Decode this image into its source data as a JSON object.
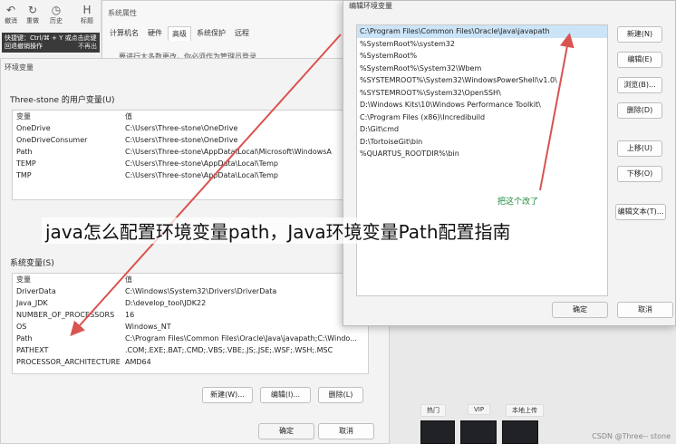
{
  "toolbar": {
    "items": [
      {
        "label": "撤消",
        "icon": "undo-icon"
      },
      {
        "label": "重做",
        "icon": "redo-icon"
      },
      {
        "label": "历史",
        "icon": "history-icon"
      },
      {
        "label": "标题",
        "icon": "heading-icon"
      }
    ],
    "tooltip": {
      "line1": "快捷键：Ctrl/⌘ + Y 或点击此键",
      "line2": "回退撤销操作",
      "right": "不再出"
    }
  },
  "system_properties": {
    "title": "系统属性",
    "tabs": [
      "计算机名",
      "硬件",
      "高级",
      "系统保护",
      "远程"
    ],
    "active_tab": "高级",
    "line": "要进行大多数更改，你必须作为管理员登录"
  },
  "env_window": {
    "title": "环境变量",
    "user_section": "Three-stone 的用户变量(U)",
    "user_headers": [
      "变量",
      "值"
    ],
    "user_vars": [
      [
        "OneDrive",
        "C:\\Users\\Three-stone\\OneDrive"
      ],
      [
        "OneDriveConsumer",
        "C:\\Users\\Three-stone\\OneDrive"
      ],
      [
        "Path",
        "C:\\Users\\Three-stone\\AppData\\Local\\Microsoft\\WindowsA"
      ],
      [
        "TEMP",
        "C:\\Users\\Three-stone\\AppData\\Local\\Temp"
      ],
      [
        "TMP",
        "C:\\Users\\Three-stone\\AppData\\Local\\Temp"
      ]
    ],
    "system_section": "系统变量(S)",
    "system_headers": [
      "变量",
      "值"
    ],
    "system_vars": [
      [
        "DriverData",
        "C:\\Windows\\System32\\Drivers\\DriverData"
      ],
      [
        "Java_JDK",
        "D:\\develop_tool\\JDK22"
      ],
      [
        "NUMBER_OF_PROCESSORS",
        "16"
      ],
      [
        "OS",
        "Windows_NT"
      ],
      [
        "Path",
        "C:\\Program Files\\Common Files\\Oracle\\Java\\javapath;C:\\Windo..."
      ],
      [
        "PATHEXT",
        ".COM;.EXE;.BAT;.CMD;.VBS;.VBE;.JS;.JSE;.WSF;.WSH;.MSC"
      ],
      [
        "PROCESSOR_ARCHITECTURE",
        "AMD64"
      ]
    ],
    "buttons": {
      "new": "新建(W)...",
      "edit": "编辑(I)...",
      "delete": "删除(L)"
    },
    "ok": "确定",
    "cancel": "取消"
  },
  "edit_dialog": {
    "title": "编辑环境变量",
    "paths": [
      "C:\\Program Files\\Common Files\\Oracle\\Java\\javapath",
      "%SystemRoot%\\system32",
      "%SystemRoot%",
      "%SystemRoot%\\System32\\Wbem",
      "%SYSTEMROOT%\\System32\\WindowsPowerShell\\v1.0\\",
      "%SYSTEMROOT%\\System32\\OpenSSH\\",
      "D:\\Windows Kits\\10\\Windows Performance Toolkit\\",
      "C:\\Program Files (x86)\\Incredibuild",
      "D:\\Git\\cmd",
      "D:\\TortoiseGit\\bin",
      "%QUARTUS_ROOTDIR%\\bin"
    ],
    "selected_index": 0,
    "note": "把这个改了",
    "buttons": [
      "新建(N)",
      "编辑(E)",
      "浏览(B)...",
      "删除(D)",
      "上移(U)",
      "下移(O)",
      "编辑文本(T)..."
    ],
    "ok": "确定",
    "cancel": "取消"
  },
  "bottom_strip": {
    "tabs": [
      "热门",
      "VIP",
      "本地上传"
    ]
  },
  "caption": "java怎么配置环境变量path，Java环境变量Path配置指南",
  "watermark": "CSDN @Three-- stone",
  "colors": {
    "selected_row": "#cce4f7",
    "arrow": "#d9534f",
    "note": "#1e8c3a"
  }
}
